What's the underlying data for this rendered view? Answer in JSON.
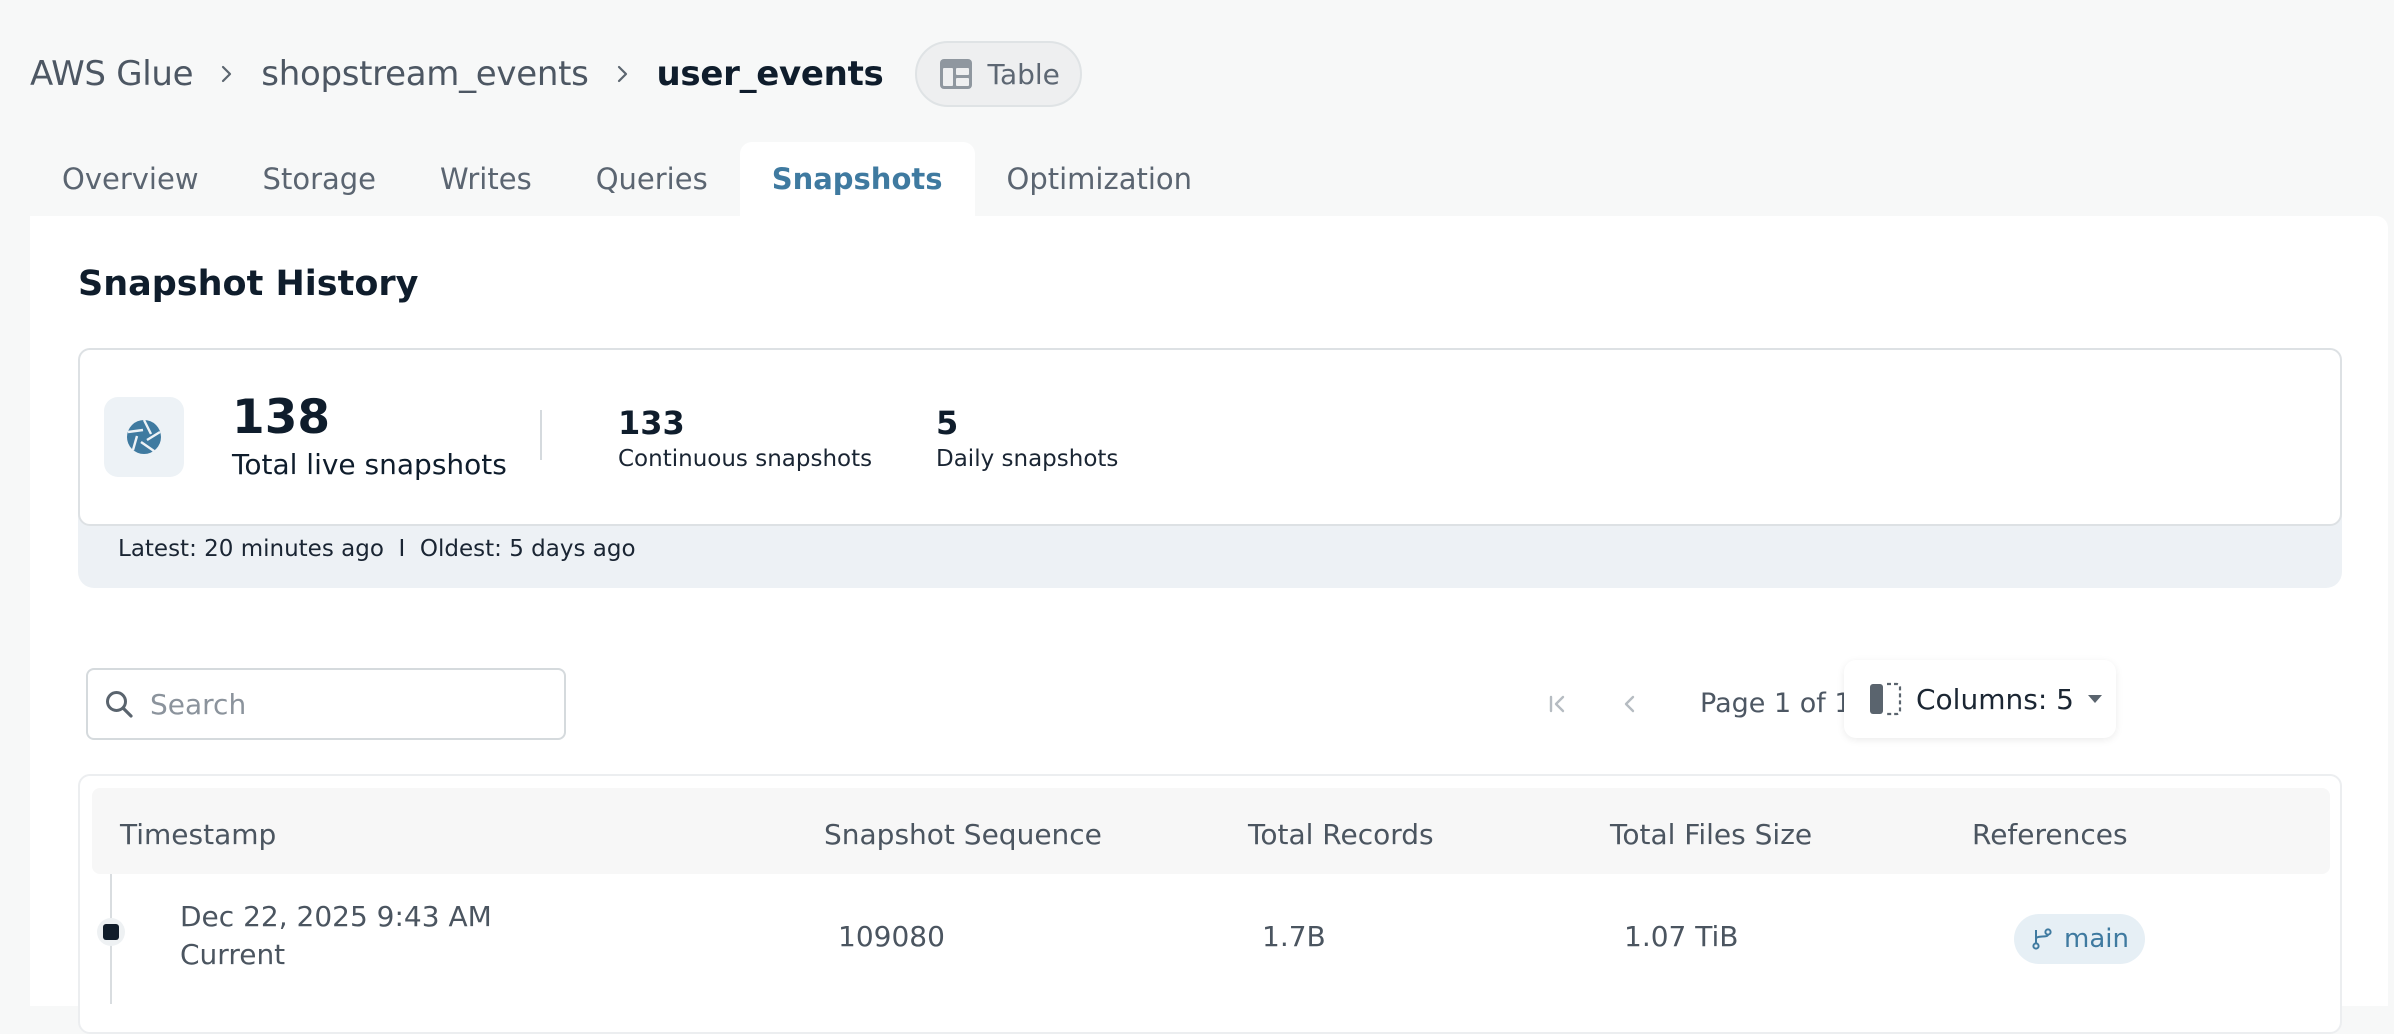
{
  "breadcrumb": {
    "root": "AWS Glue",
    "database": "shopstream_events",
    "table": "user_events",
    "type_label": "Table"
  },
  "tabs": [
    {
      "label": "Overview",
      "active": false
    },
    {
      "label": "Storage",
      "active": false
    },
    {
      "label": "Writes",
      "active": false
    },
    {
      "label": "Queries",
      "active": false
    },
    {
      "label": "Snapshots",
      "active": true
    },
    {
      "label": "Optimization",
      "active": false
    }
  ],
  "section_title": "Snapshot History",
  "stats": {
    "total_value": "138",
    "total_label": "Total live snapshots",
    "continuous_value": "133",
    "continuous_label": "Continuous snapshots",
    "daily_value": "5",
    "daily_label": "Daily snapshots",
    "footer": "Latest: 20 minutes ago  I  Oldest: 5 days ago"
  },
  "search": {
    "placeholder": "Search",
    "value": ""
  },
  "pagination": {
    "text": "Page 1 of 14"
  },
  "columns_button": {
    "label": "Columns: 5"
  },
  "table": {
    "headers": [
      "Timestamp",
      "Snapshot Sequence",
      "Total Records",
      "Total Files Size",
      "References"
    ],
    "rows": [
      {
        "timestamp": "Dec 22, 2025 9:43 AM",
        "status": "Current",
        "sequence": "109080",
        "records": "1.7B",
        "size": "1.07 TiB",
        "reference": "main"
      }
    ]
  },
  "icons": {
    "breadcrumb_separator": "chevron-right-icon",
    "type": "table-icon",
    "stats": "aperture-icon",
    "search": "search-icon",
    "columns": "columns-icon",
    "reference": "git-branch-icon"
  },
  "colors": {
    "accent": "#3f7aa0",
    "background": "#f7f8f8",
    "text_dark": "#0f1d2c"
  }
}
